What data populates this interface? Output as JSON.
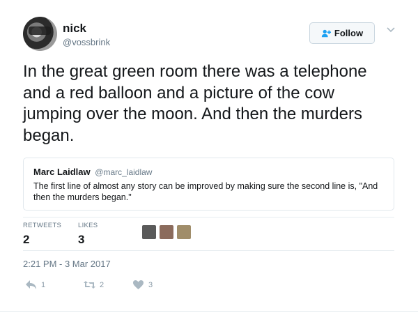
{
  "user": {
    "name": "nick",
    "handle": "@vossbrink",
    "avatar_icon": "user-avatar"
  },
  "follow_button": {
    "label": "Follow",
    "icon": "follow-user-plus-icon"
  },
  "menu_icon": "chevron-down-icon",
  "tweet": {
    "text": "In the great green room there was a telephone and a red balloon and a picture of the cow jumping over the moon. And then the murders began."
  },
  "quote": {
    "name": "Marc Laidlaw",
    "handle": "@marc_laidlaw",
    "text": "The first line of almost any story can be improved by making sure the second line is, \"And then the murders began.\""
  },
  "stats": {
    "retweets_label": "RETWEETS",
    "retweets_value": "2",
    "likes_label": "LIKES",
    "likes_value": "3"
  },
  "likers": [
    {
      "icon": "liker-avatar-1",
      "color": "#5a5a5a"
    },
    {
      "icon": "liker-avatar-2",
      "color": "#8b6b5c"
    },
    {
      "icon": "liker-avatar-3",
      "color": "#a08d6a"
    }
  ],
  "timestamp": "2:21 PM - 3 Mar 2017",
  "actions": {
    "reply_count": "1",
    "retweet_count": "2",
    "like_count": "3"
  },
  "colors": {
    "text": "#14171a",
    "secondary": "#657786",
    "icon": "#8899a6",
    "border": "#e1e8ed",
    "follow_accent": "#1da1f2"
  }
}
